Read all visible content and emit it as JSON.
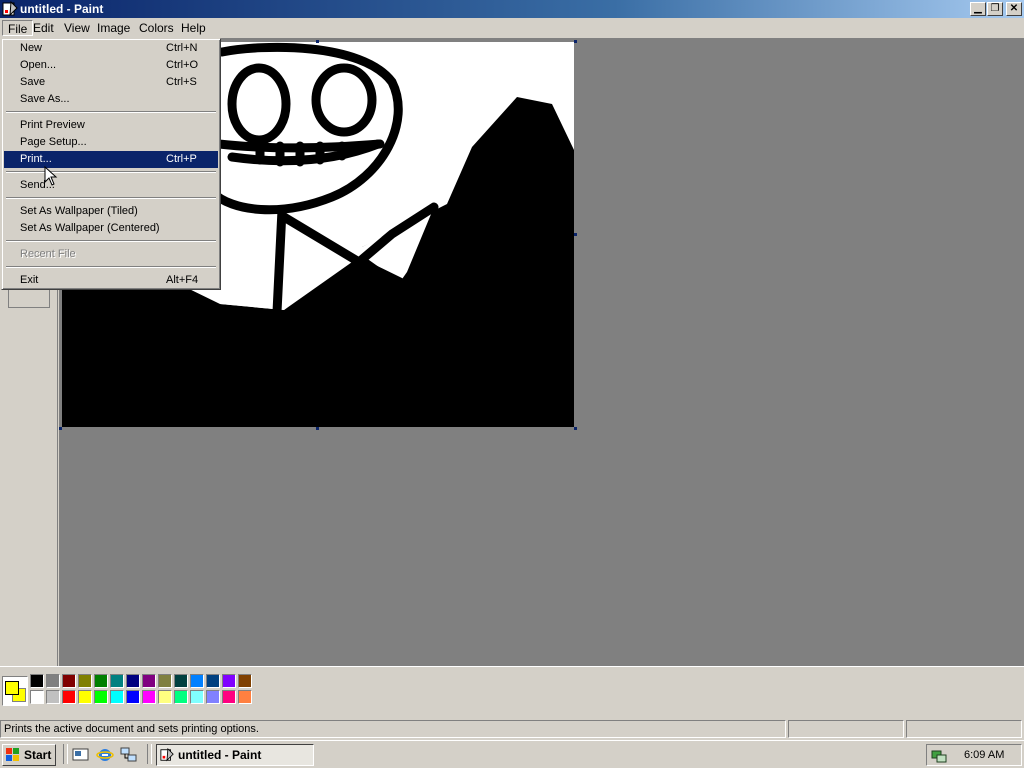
{
  "window": {
    "title": "untitled - Paint"
  },
  "menubar": {
    "items": [
      "File",
      "Edit",
      "View",
      "Image",
      "Colors",
      "Help"
    ]
  },
  "file_menu": {
    "items": [
      {
        "label": "New",
        "shortcut": "Ctrl+N"
      },
      {
        "label": "Open...",
        "shortcut": "Ctrl+O"
      },
      {
        "label": "Save",
        "shortcut": "Ctrl+S"
      },
      {
        "label": "Save As...",
        "shortcut": ""
      },
      {
        "label": "Print Preview",
        "shortcut": ""
      },
      {
        "label": "Page Setup...",
        "shortcut": ""
      },
      {
        "label": "Print...",
        "shortcut": "Ctrl+P",
        "highlighted": true
      },
      {
        "label": "Send...",
        "shortcut": ""
      },
      {
        "label": "Set As Wallpaper (Tiled)",
        "shortcut": ""
      },
      {
        "label": "Set As Wallpaper (Centered)",
        "shortcut": ""
      },
      {
        "label": "Recent File",
        "shortcut": "",
        "disabled": true
      },
      {
        "label": "Exit",
        "shortcut": "Alt+F4"
      }
    ]
  },
  "palette": {
    "foreground": "#ffff00",
    "background": "#ffff00",
    "colors_top": [
      "#000000",
      "#808080",
      "#800000",
      "#808000",
      "#008000",
      "#008080",
      "#000080",
      "#800080",
      "#808040",
      "#004040",
      "#0080ff",
      "#004080",
      "#8000ff",
      "#804000"
    ],
    "colors_bottom": [
      "#ffffff",
      "#c0c0c0",
      "#ff0000",
      "#ffff00",
      "#00ff00",
      "#00ffff",
      "#0000ff",
      "#ff00ff",
      "#ffff80",
      "#00ff80",
      "#80ffff",
      "#8080ff",
      "#ff0080",
      "#ff8040"
    ]
  },
  "statusbar": {
    "message": "Prints the active document and sets printing options."
  },
  "taskbar": {
    "start_label": "Start",
    "quicklaunch": [
      "show-desktop-icon",
      "internet-explorer-icon",
      "network-icon"
    ],
    "task_label": "untitled - Paint",
    "clock": "6:09 AM"
  }
}
